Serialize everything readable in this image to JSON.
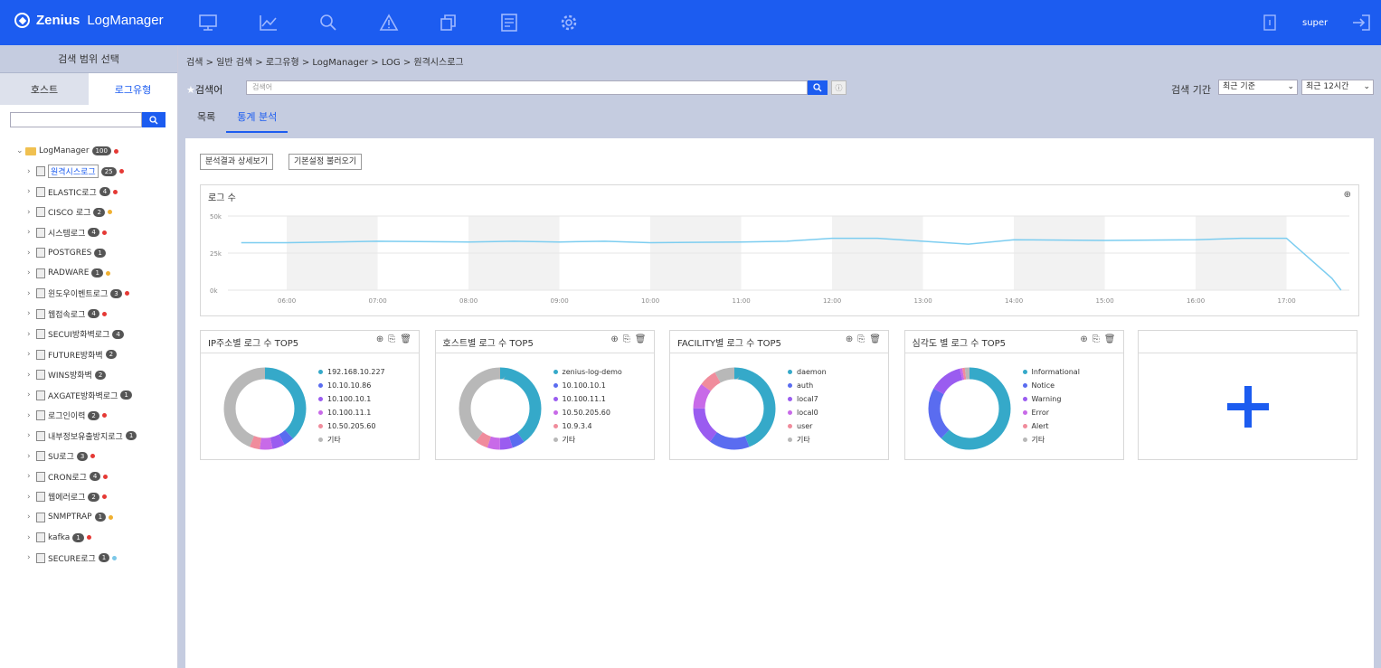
{
  "app": {
    "brand": "Zenius",
    "product": "LogManager",
    "user": "super"
  },
  "nav_icons": [
    "monitor-icon",
    "chart-icon",
    "search-icon",
    "alert-icon",
    "copy-icon",
    "document-icon",
    "gear-icon"
  ],
  "sidebar": {
    "title": "검색 범위 선택",
    "tabs": [
      "호스트",
      "로그유형"
    ],
    "root": {
      "label": "LogManager",
      "badge": "100"
    },
    "items": [
      {
        "label": "원격시스로그",
        "badge": "25",
        "dot": "#e53935",
        "selected": true
      },
      {
        "label": "ELASTIC로그",
        "badge": "4",
        "dot": "#e53935"
      },
      {
        "label": "CISCO 로그",
        "badge": "2",
        "dot": "#f0b030"
      },
      {
        "label": "시스템로그",
        "badge": "4",
        "dot": "#e53935"
      },
      {
        "label": "POSTGRES",
        "badge": "1",
        "dot": ""
      },
      {
        "label": "RADWARE",
        "badge": "1",
        "dot": "#f0b030"
      },
      {
        "label": "윈도우이벤트로그",
        "badge": "3",
        "dot": "#e53935"
      },
      {
        "label": "웹접속로그",
        "badge": "4",
        "dot": "#e53935"
      },
      {
        "label": "SECUI방화벽로그",
        "badge": "4",
        "dot": ""
      },
      {
        "label": "FUTURE방화벽",
        "badge": "2",
        "dot": ""
      },
      {
        "label": "WINS방화벽",
        "badge": "2",
        "dot": ""
      },
      {
        "label": "AXGATE방화벽로그",
        "badge": "1",
        "dot": ""
      },
      {
        "label": "로그인이력",
        "badge": "2",
        "dot": "#e53935"
      },
      {
        "label": "내부정보유출방지로그",
        "badge": "1",
        "dot": ""
      },
      {
        "label": "SU로그",
        "badge": "3",
        "dot": "#e53935"
      },
      {
        "label": "CRON로그",
        "badge": "4",
        "dot": "#e53935"
      },
      {
        "label": "웹에러로그",
        "badge": "2",
        "dot": "#e53935"
      },
      {
        "label": "SNMPTRAP",
        "badge": "1",
        "dot": "#f0b030"
      },
      {
        "label": "kafka",
        "badge": "1",
        "dot": "#e53935"
      },
      {
        "label": "SECURE로그",
        "badge": "1",
        "dot": "#7cc8e8"
      }
    ]
  },
  "main": {
    "breadcrumb": "검색 > 일반 검색 > 로그유형 > LogManager > LOG > 원격시스로그",
    "keyword_label": "검색어",
    "keyword_placeholder": "검색어",
    "period_label": "검색 기간",
    "period_basis": "최근 기준",
    "period_range": "최근 12시간",
    "tabs": [
      "목록",
      "통계 분석"
    ],
    "buttons": [
      "분석결과 상세보기",
      "기본설정 불러오기"
    ]
  },
  "line_chart": {
    "title": "로그 수"
  },
  "chart_data": [
    {
      "type": "line",
      "title": "로그 수",
      "x": [
        "06:00",
        "07:00",
        "08:00",
        "09:00",
        "10:00",
        "11:00",
        "12:00",
        "13:00",
        "14:00",
        "15:00",
        "16:00",
        "17:00"
      ],
      "ytick_labels": [
        "0k",
        "25k",
        "50k"
      ],
      "ylim": [
        0,
        50000
      ],
      "points": [
        [
          5.5,
          32000
        ],
        [
          6,
          32000
        ],
        [
          7,
          33000
        ],
        [
          8,
          32500
        ],
        [
          8.5,
          33000
        ],
        [
          9,
          32500
        ],
        [
          9.5,
          33000
        ],
        [
          10,
          32000
        ],
        [
          11,
          32500
        ],
        [
          11.5,
          33000
        ],
        [
          12,
          35000
        ],
        [
          12.5,
          35000
        ],
        [
          13,
          33000
        ],
        [
          13.5,
          31000
        ],
        [
          14,
          34000
        ],
        [
          15,
          33500
        ],
        [
          16,
          34000
        ],
        [
          16.5,
          35000
        ],
        [
          17,
          35000
        ],
        [
          17.5,
          8000
        ],
        [
          17.6,
          0
        ]
      ]
    },
    {
      "type": "pie",
      "title": "IP주소별 로그 수 TOP5",
      "labels": [
        "192.168.10.227",
        "10.10.10.86",
        "10.100.10.1",
        "10.100.11.1",
        "10.50.205.60",
        "기타"
      ],
      "values": [
        38,
        4,
        5,
        5,
        4,
        44
      ]
    },
    {
      "type": "pie",
      "title": "호스트별 로그 수 TOP5",
      "labels": [
        "zenius-log-demo",
        "10.100.10.1",
        "10.100.11.1",
        "10.50.205.60",
        "10.9.3.4",
        "기타"
      ],
      "values": [
        40,
        5,
        5,
        5,
        5,
        40
      ]
    },
    {
      "type": "pie",
      "title": "FACILITY별 로그 수 TOP5",
      "labels": [
        "daemon",
        "auth",
        "local7",
        "local0",
        "user",
        "기타"
      ],
      "values": [
        44,
        16,
        15,
        10,
        7,
        8
      ]
    },
    {
      "type": "pie",
      "title": "심각도 별 로그 수 TOP5",
      "labels": [
        "Informational",
        "Notice",
        "Warning",
        "Error",
        "Alert",
        "기타"
      ],
      "values": [
        62,
        21,
        13,
        1,
        1,
        2
      ]
    }
  ],
  "colors": {
    "brand": "#1c5cf0",
    "line": "#7ccdf0",
    "slices": [
      "#35a9c9",
      "#5a6cf0",
      "#9a5cf0",
      "#c86ae8",
      "#f08c9c",
      "#b8b8b8"
    ]
  }
}
